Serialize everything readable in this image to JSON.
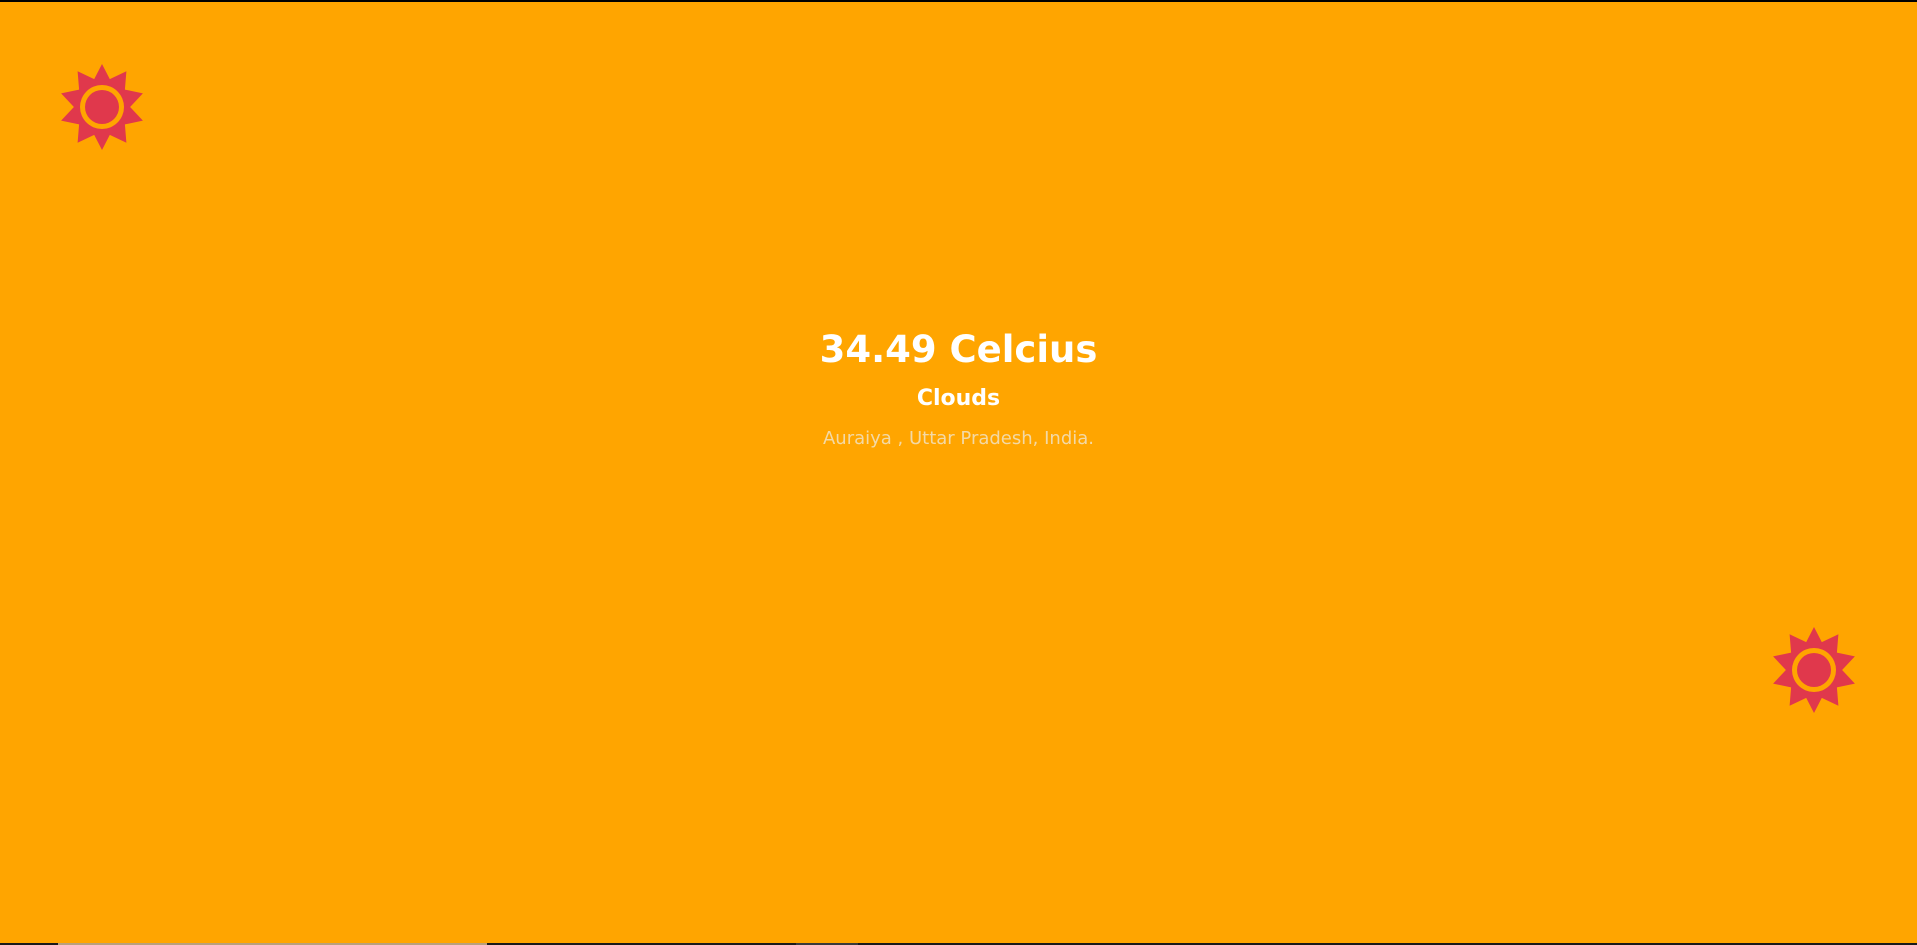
{
  "weather": {
    "temperature": "34.49 Celcius",
    "condition": "Clouds",
    "location": "Auraiya , Uttar Pradesh, India."
  },
  "icons": {
    "top_left": "sun-icon",
    "bottom_right": "sun-icon"
  },
  "colors": {
    "background": "#ffa500",
    "sun": "#e0384c",
    "text": "#ffffff",
    "location_text": "#f3d9a6"
  }
}
